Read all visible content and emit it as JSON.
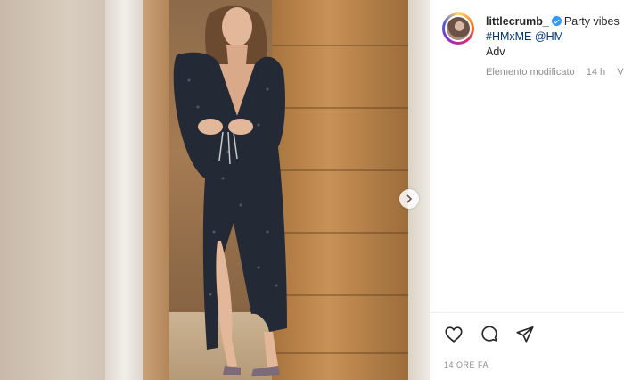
{
  "post": {
    "username": "littlecrumb_",
    "caption_text": "Party vibes",
    "hashtag": "#HMxME",
    "mention": "@HM",
    "adv": "Adv",
    "edited_label": "Elemento modificato",
    "age": "14 h",
    "reply_partial": "Vi",
    "timestamp": "14 ORE FA"
  },
  "icons": {
    "like": "heart-icon",
    "comment": "comment-icon",
    "share": "paper-plane-icon",
    "next": "chevron-right-icon",
    "verified": "verified-badge-icon"
  },
  "colors": {
    "accent": "#3897f0",
    "link": "#00376b",
    "text": "#262626",
    "muted": "#8e8e8e"
  }
}
